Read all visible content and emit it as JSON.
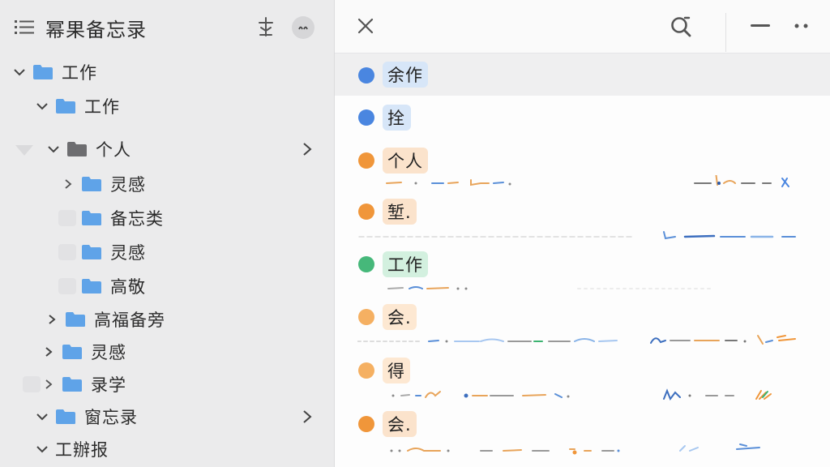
{
  "sidebar": {
    "title": "幂果备忘录",
    "tree": [
      {
        "label": "工作",
        "expanded": true,
        "level": 0
      },
      {
        "label": "工作",
        "expanded": true,
        "level": 1
      },
      {
        "label": "个人",
        "expanded": true,
        "level": 1,
        "dark": true
      },
      {
        "label": "灵感",
        "expanded": false,
        "level": 2
      },
      {
        "label": "备忘类",
        "level": 2
      },
      {
        "label": "灵感",
        "level": 2
      },
      {
        "label": "高敬",
        "level": 2
      },
      {
        "label": "高福备旁",
        "expanded": false,
        "level": 1
      },
      {
        "label": "灵感",
        "expanded": false,
        "level": 1
      },
      {
        "label": "录学",
        "expanded": false,
        "level": 1
      },
      {
        "label": "窗忘录",
        "expanded": true,
        "level": 1
      },
      {
        "label": "工辦报",
        "expanded": true,
        "level": 1
      }
    ]
  },
  "notes": [
    {
      "tag": "余作",
      "dot_color": "#4a86e0",
      "tag_bg": "#d7e6f8"
    },
    {
      "tag": "拴঻",
      "dot_color": "#4a86e0",
      "tag_bg": "#d7e6f8"
    },
    {
      "tag": "个人",
      "dot_color": "#f0963a",
      "tag_bg": "#fbe3cc"
    },
    {
      "tag": "堑.",
      "dot_color": "#f0963a",
      "tag_bg": "#fbe3cc"
    },
    {
      "tag": "工作",
      "dot_color": "#46b87a",
      "tag_bg": "#d3f0df"
    },
    {
      "tag": "会.",
      "dot_color": "#f5b062",
      "tag_bg": "#fde8d2"
    },
    {
      "tag": "得",
      "dot_color": "#f5b062",
      "tag_bg": "#fde8d2"
    },
    {
      "tag": "会.",
      "dot_color": "#f0963a",
      "tag_bg": "#fbe3cc"
    }
  ],
  "colors": {
    "accent_blue": "#4a86e0",
    "folder_blue": "#5fa3e8",
    "folder_dark": "#6d6d70"
  }
}
